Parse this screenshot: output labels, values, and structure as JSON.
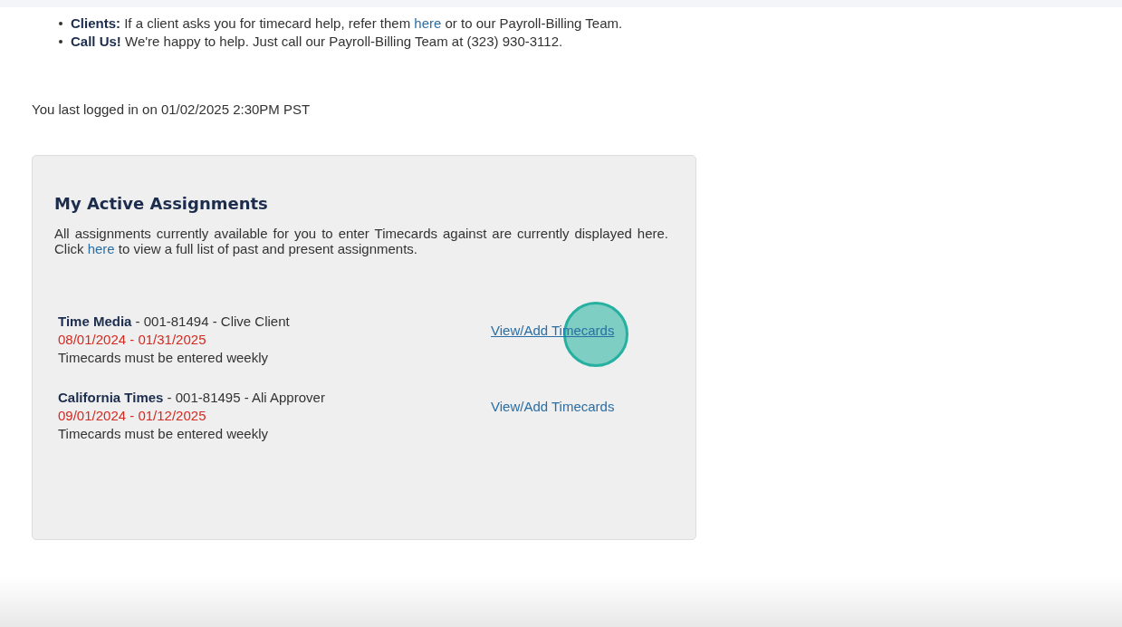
{
  "notices": [
    {
      "term": "Clients:",
      "text": " If a client asks you for timecard help, refer them ",
      "link": "here",
      "after": " or to our Payroll-Billing Team."
    },
    {
      "term": "Call Us!",
      "text": " We're happy to help. Just call our Payroll-Billing Team at (323) 930-3112."
    }
  ],
  "last_login": "You last logged in on 01/02/2025 2:30PM PST",
  "card": {
    "title": "My Active Assignments",
    "intro": "All assignments currently available for you to enter Timecards against are currently displayed here. Click ",
    "intro_link": "here",
    "intro_after": " to view a full list of past and present assignments.",
    "assignments": [
      {
        "company": "Time Media",
        "details": " - 001-81494 - Clive Client",
        "dates": "08/01/2024 - 01/31/2025",
        "note": "Timecards must be entered weekly",
        "link": "View/Add Timecards",
        "hovered": true
      },
      {
        "company": "California Times",
        "details": " - 001-81495 - Ali Approver",
        "dates": "09/01/2024 - 01/12/2025",
        "note": "Timecards must be entered weekly",
        "link": "View/Add Timecards",
        "hovered": false
      }
    ]
  }
}
